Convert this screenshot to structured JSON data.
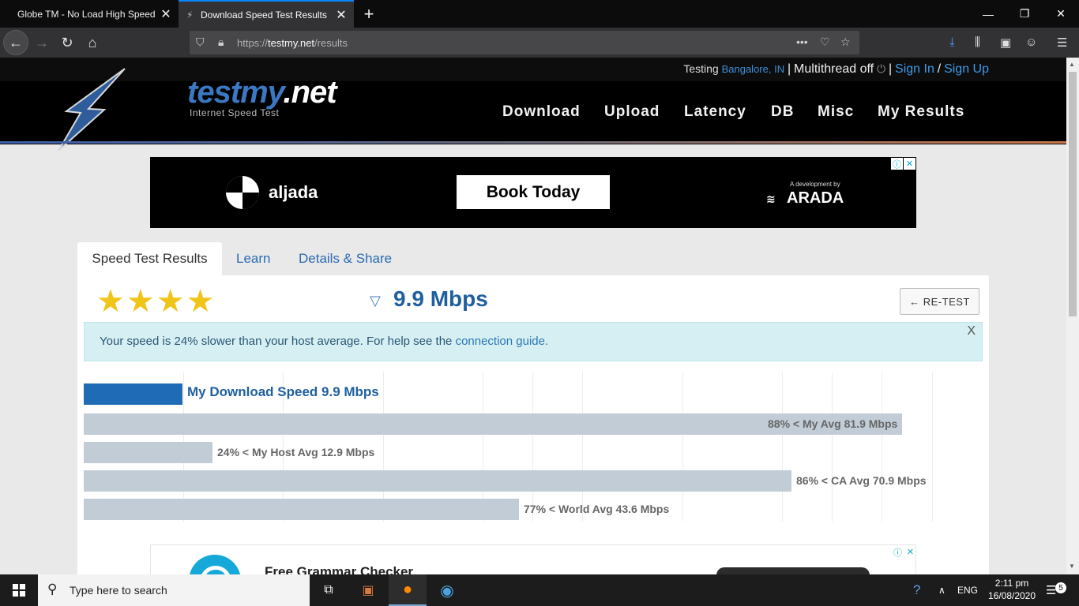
{
  "browser": {
    "tabs": [
      {
        "title": "Globe TM - No Load High Speed",
        "active": false
      },
      {
        "title": "Download Speed Test Results",
        "active": true
      }
    ],
    "url_prefix": "https://",
    "url_host": "testmy.net",
    "url_path": "/results"
  },
  "site": {
    "testing_label": "Testing",
    "location": "Bangalore, IN",
    "multithread": "Multithread off",
    "sign_in": "Sign In",
    "sign_up": "Sign Up",
    "separator": "|",
    "slash": "/",
    "logo_text_a": "testmy",
    "logo_text_b": ".net",
    "logo_sub": "Internet Speed Test",
    "nav": [
      "Download",
      "Upload",
      "Latency",
      "DB",
      "Misc",
      "My Results"
    ]
  },
  "ad_top": {
    "brand": "aljada",
    "cta": "Book Today",
    "dev_note": "A development by",
    "partner": "ARADA"
  },
  "results": {
    "tabs": [
      "Speed Test Results",
      "Learn",
      "Details & Share"
    ],
    "stars": "★★★★",
    "rating": 4,
    "speed": "9.9 Mbps",
    "retest": "← RE-TEST",
    "alert_text": "Your speed is 24% slower than your host average. For help see the ",
    "alert_link": "connection guide.",
    "alert_close": "X"
  },
  "chart_data": {
    "type": "bar",
    "categories": [
      "My Download Speed",
      "My Avg",
      "My Host Avg",
      "CA Avg",
      "World Avg"
    ],
    "values": [
      9.9,
      81.9,
      12.9,
      70.9,
      43.6
    ],
    "labels": [
      "My Download Speed 9.9 Mbps",
      "88% < My Avg 81.9 Mbps",
      "24% < My Host Avg 12.9 Mbps",
      "86% < CA Avg 70.9 Mbps",
      "77% < World Avg 43.6 Mbps"
    ],
    "colors": [
      "#1f6bb5",
      "#c2ccd6",
      "#c2ccd6",
      "#c2ccd6",
      "#c2ccd6"
    ],
    "xlim": [
      0,
      90
    ]
  },
  "ad_bottom": {
    "title": "Free Grammar Checker"
  },
  "taskbar": {
    "search_placeholder": "Type here to search",
    "lang": "ENG",
    "time": "2:11 pm",
    "date": "16/08/2020",
    "notifications": "5"
  }
}
